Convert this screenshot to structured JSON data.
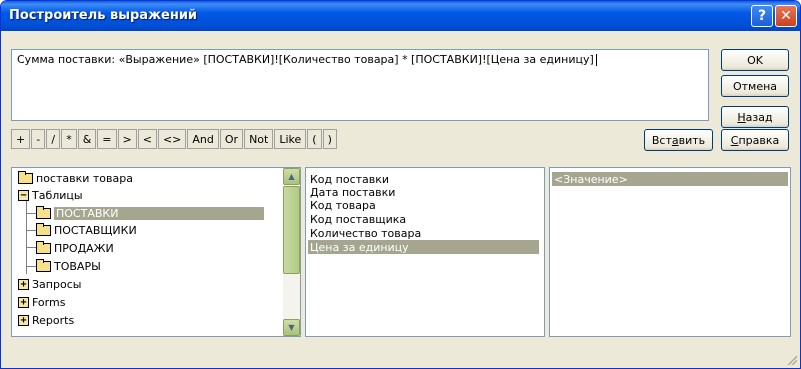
{
  "window": {
    "title": "Построитель выражений",
    "help_glyph": "?",
    "close_glyph": "✕"
  },
  "expression": {
    "text": "Сумма поставки: «Выражение» [ПОСТАВКИ]![Количество товара] * [ПОСТАВКИ]![Цена за единицу]"
  },
  "buttons": {
    "ok": "OK",
    "cancel": "Отмена",
    "back_pre": "",
    "back_ul": "Н",
    "back_post": "азад",
    "paste_pre": "Вст",
    "paste_ul": "а",
    "paste_post": "вить",
    "help_pre": "",
    "help_ul": "С",
    "help_post": "правка"
  },
  "operators": [
    "+",
    "-",
    "/",
    "*",
    "&",
    "=",
    ">",
    "<",
    "<>",
    "And",
    "Or",
    "Not",
    "Like",
    "(",
    ")"
  ],
  "tree": [
    {
      "label": "поставки товара",
      "level": 0,
      "kind": "folder"
    },
    {
      "label": "Таблицы",
      "level": 0,
      "kind": "expanded"
    },
    {
      "label": "ПОСТАВКИ",
      "level": 1,
      "kind": "folder-open",
      "selected": true
    },
    {
      "label": "ПОСТАВЩИКИ",
      "level": 1,
      "kind": "folder"
    },
    {
      "label": "ПРОДАЖИ",
      "level": 1,
      "kind": "folder"
    },
    {
      "label": "ТОВАРЫ",
      "level": 1,
      "kind": "folder"
    },
    {
      "label": "Запросы",
      "level": 0,
      "kind": "collapsed"
    },
    {
      "label": "Forms",
      "level": 0,
      "kind": "collapsed"
    },
    {
      "label": "Reports",
      "level": 0,
      "kind": "collapsed"
    }
  ],
  "fields": [
    {
      "label": "Код поставки"
    },
    {
      "label": "Дата поставки"
    },
    {
      "label": "Код товара"
    },
    {
      "label": "Код поставщика"
    },
    {
      "label": "Количество товара"
    },
    {
      "label": "Цена за единицу",
      "selected": true
    }
  ],
  "values": [
    {
      "label": "<Значение>",
      "selected": true
    }
  ],
  "colors": {
    "titlebar": "#0058e6",
    "selection": "#a6a690",
    "dialog_bg": "#ece9d8"
  }
}
